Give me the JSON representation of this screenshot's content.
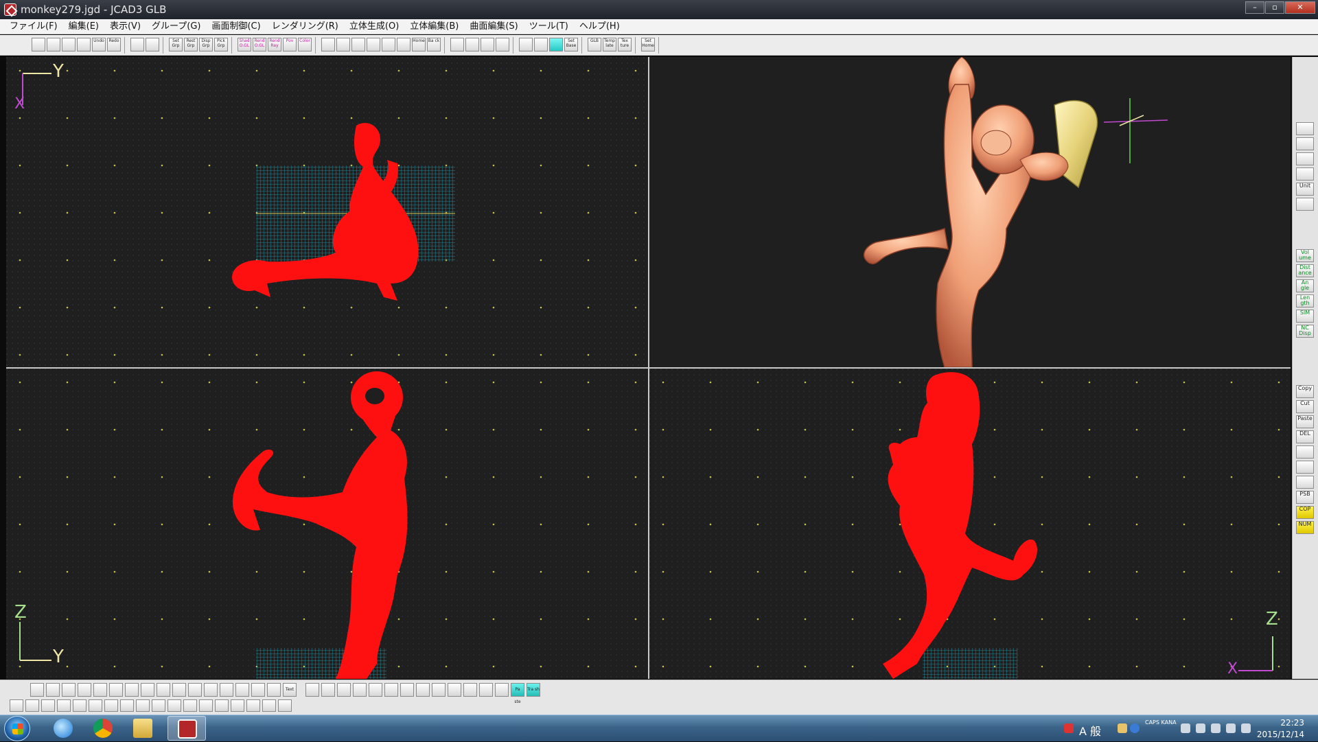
{
  "window": {
    "title": "monkey279.jgd - JCAD3 GLB",
    "controls": [
      "–",
      "▫",
      "✕"
    ]
  },
  "menu": [
    "ファイル(F)",
    "編集(E)",
    "表示(V)",
    "グループ(G)",
    "画面制御(C)",
    "レンダリング(R)",
    "立体生成(O)",
    "立体編集(B)",
    "曲面編集(S)",
    "ツール(T)",
    "ヘルプ(H)"
  ],
  "toolbar": {
    "groups": [
      [
        {
          "label": "",
          "icon": "new-file-icon"
        },
        {
          "label": "",
          "icon": "open-folder-icon"
        },
        {
          "label": "",
          "icon": "save-icon"
        },
        {
          "label": "",
          "icon": "print-icon"
        },
        {
          "label": "Undo",
          "icon": "undo-icon"
        },
        {
          "label": "Redo",
          "icon": "redo-icon"
        }
      ],
      [
        {
          "label": "",
          "icon": "group-icon"
        },
        {
          "label": "",
          "icon": "grid-icon"
        }
      ],
      [
        {
          "label": "Set Grp",
          "icon": "set-group-icon"
        },
        {
          "label": "Rest Grp",
          "icon": "reset-group-icon"
        },
        {
          "label": "Disp Grp",
          "icon": "display-group-icon"
        },
        {
          "label": "Pick Grp",
          "icon": "pick-group-icon"
        }
      ],
      [
        {
          "label": "Shad O.GL",
          "icon": "shade-icon"
        },
        {
          "label": "Rend O.GL",
          "icon": "render-icon"
        },
        {
          "label": "Rend Ray",
          "icon": "render-ray-icon"
        },
        {
          "label": "Pov",
          "icon": "pov-icon"
        },
        {
          "label": "Color",
          "icon": "color-icon"
        }
      ],
      [
        {
          "label": "",
          "icon": "zoom-in-icon"
        },
        {
          "label": "",
          "icon": "zoom-out-icon"
        },
        {
          "label": "",
          "icon": "zoom-fit-icon"
        },
        {
          "label": "",
          "icon": "zoom-window-icon"
        },
        {
          "label": "",
          "icon": "zoom-box-icon"
        },
        {
          "label": "",
          "icon": "pan-hand-icon"
        },
        {
          "label": "Home",
          "icon": "home-view-icon"
        },
        {
          "label": "Ba ck",
          "icon": "back-view-icon"
        }
      ],
      [
        {
          "label": "",
          "icon": "measure-icon"
        },
        {
          "label": "",
          "icon": "search-icon"
        },
        {
          "label": "",
          "icon": "pick-icon"
        },
        {
          "label": "",
          "icon": "frame-icon"
        }
      ],
      [
        {
          "label": "",
          "icon": "grid-dots-icon"
        },
        {
          "label": "",
          "icon": "snap-grid-icon"
        },
        {
          "label": "",
          "icon": "grid-toggle-icon"
        },
        {
          "label": "Set Base",
          "icon": "set-base-icon"
        }
      ],
      [
        {
          "label": "GLB",
          "icon": "glb-icon"
        },
        {
          "label": "Temp late",
          "icon": "template-icon"
        },
        {
          "label": "Tex ture",
          "icon": "texture-icon"
        }
      ],
      [
        {
          "label": "Set Home",
          "icon": "set-home-icon"
        }
      ]
    ]
  },
  "viewports": {
    "top": {
      "axes": [
        "Y",
        "X"
      ]
    },
    "perspective": {
      "axes": []
    },
    "front": {
      "axes": [
        "Z",
        "Y"
      ]
    },
    "side": {
      "axes": [
        "Z",
        "X"
      ]
    }
  },
  "right_palette": {
    "top": [
      "",
      "",
      "",
      "",
      "Unit",
      ""
    ],
    "measure": [
      "Vol ume",
      "Dist ance",
      "An gle",
      "Len gth",
      "SIM",
      "NC Disp"
    ],
    "edit": [
      "Copy",
      "Cut",
      "Paste",
      "DEL",
      "",
      "",
      "",
      "PSB",
      "COP",
      "NUM"
    ]
  },
  "bottom_toolbar": {
    "row1": [
      "",
      "",
      "",
      "",
      "",
      "",
      "",
      "",
      "",
      "",
      "",
      "",
      "",
      "",
      "",
      "",
      "Text",
      "",
      "",
      "",
      "",
      "",
      "",
      "",
      "",
      "",
      "",
      "",
      "",
      "",
      "Pa ste",
      "Tra sh"
    ],
    "row2": [
      "",
      "",
      "",
      "",
      "",
      "",
      "",
      "",
      "",
      "",
      "",
      "",
      "",
      "",
      "",
      "",
      "",
      ""
    ]
  },
  "taskbar": {
    "apps": [
      "ie",
      "chrome",
      "explorer",
      "jcad"
    ],
    "ime": "A 般",
    "caps": "CAPS KANA",
    "time": "22:23",
    "date": "2015/12/14"
  },
  "colors": {
    "viewport_bg": "#1f1f1f",
    "wireframe": "#ff1010",
    "grid_cyan": "#1f9fb0",
    "render_skin": "#f2a27a",
    "banana": "#efe08f"
  }
}
